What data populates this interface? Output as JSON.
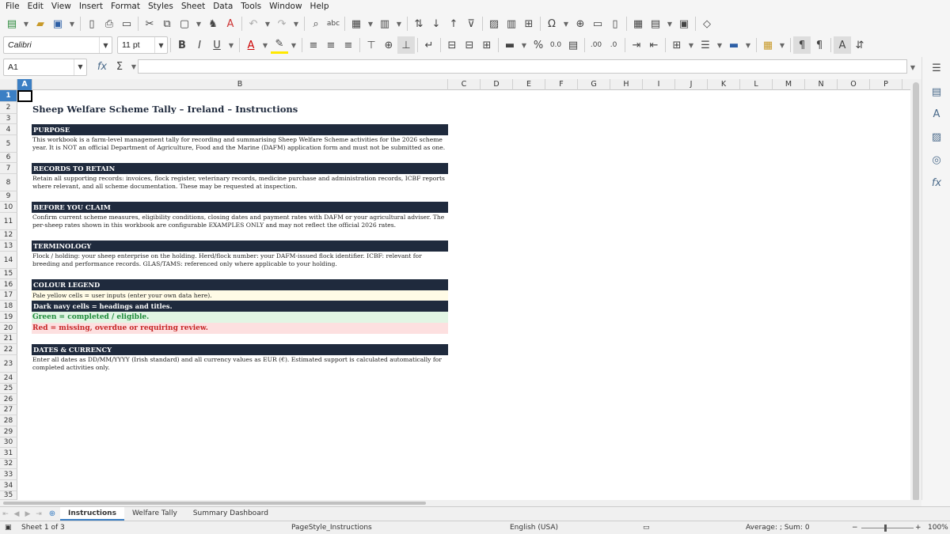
{
  "menu": [
    "File",
    "Edit",
    "View",
    "Insert",
    "Format",
    "Styles",
    "Sheet",
    "Data",
    "Tools",
    "Window",
    "Help"
  ],
  "toolbar": {
    "font_name": "Calibri",
    "font_size": "11 pt"
  },
  "formula_bar": {
    "cell_ref": "A1",
    "content": ""
  },
  "columns": [
    "A",
    "B",
    "C",
    "D",
    "E",
    "F",
    "G",
    "H",
    "I",
    "J",
    "K",
    "L",
    "M",
    "N",
    "O",
    "P"
  ],
  "rows": [
    "1",
    "2",
    "3",
    "4",
    "5",
    "6",
    "7",
    "8",
    "9",
    "10",
    "11",
    "12",
    "13",
    "14",
    "15",
    "16",
    "17",
    "18",
    "19",
    "20",
    "21",
    "22",
    "23",
    "24",
    "25",
    "26",
    "27",
    "28",
    "29",
    "30",
    "31",
    "32",
    "33",
    "34",
    "35"
  ],
  "content": {
    "title": "Sheep Welfare Scheme Tally – Ireland – Instructions",
    "purpose_h": "PURPOSE",
    "purpose_t": "This workbook is a farm-level management tally for recording and summarising Sheep Welfare Scheme activities for the 2026 scheme year. It is NOT an official Department of Agriculture, Food and the Marine (DAFM) application form and must not be submitted as one.",
    "records_h": "RECORDS TO RETAIN",
    "records_t": "Retain all supporting records: invoices, flock register, veterinary records, medicine purchase and administration records, ICBF reports where relevant, and all scheme documentation. These may be requested at inspection.",
    "before_h": "BEFORE YOU CLAIM",
    "before_t": "Confirm current scheme measures, eligibility conditions, closing dates and payment rates with DAFM or your agricultural adviser. The per-sheep rates shown in this workbook are configurable EXAMPLES ONLY and may not reflect the official 2026 rates.",
    "term_h": "TERMINOLOGY",
    "term_t": "Flock / holding: your sheep enterprise on the holding. Herd/flock number: your DAFM-issued flock identifier. ICBF: relevant for breeding and performance records. GLAS/TAMS: referenced only where applicable to your holding.",
    "legend_h": "COLOUR LEGEND",
    "legend_yellow": "Pale yellow cells = user inputs (enter your own data here).",
    "legend_navy": "Dark navy cells = headings and titles.",
    "legend_green": "Green = completed / eligible.",
    "legend_red": "Red = missing, overdue or requiring review.",
    "dates_h": "DATES & CURRENCY",
    "dates_t": "Enter all dates as DD/MM/YYYY (Irish standard) and all currency values as EUR (€). Estimated support is calculated automatically for completed activities only."
  },
  "sheets": [
    "Instructions",
    "Welfare Tally",
    "Summary Dashboard"
  ],
  "status": {
    "sheet": "Sheet 1 of 3",
    "page_style": "PageStyle_Instructions",
    "language": "English (USA)",
    "sum": "Average: ; Sum: 0",
    "zoom": "100%"
  }
}
